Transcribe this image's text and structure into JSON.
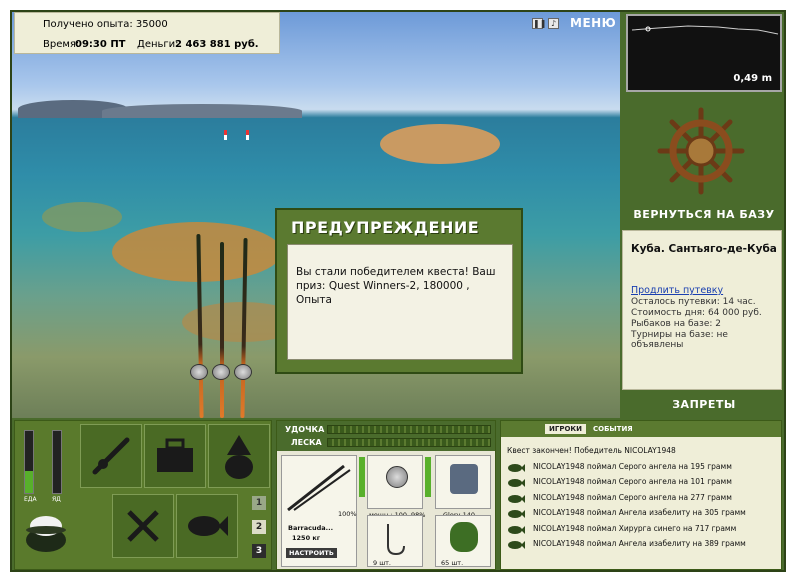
{
  "info": {
    "experience_label": "Получено опыта:",
    "experience_value": "35000",
    "time_label": "Время:",
    "time_value": "09:30 ПТ",
    "money_label": "Деньги:",
    "money_value": "2 463 881 руб."
  },
  "top_icons": [
    "pause-icon",
    "sound-icon"
  ],
  "menu_label": "МЕНЮ",
  "depth": {
    "value": "0,49 m"
  },
  "return_label": "ВЕРНУТЬСЯ НА БАЗУ",
  "location": {
    "city": "Куба. Сантьяго-де-Куба",
    "extend_link": "Продлить путевку",
    "remaining": "Осталось путевки: 14 час.",
    "day_cost": "Стоимость дня: 64 000 руб.",
    "fishers": "Рыбаков на базе: 2",
    "tournaments": "Турниры на базе: не объявлены"
  },
  "bans_label": "ЗАПРЕТЫ",
  "dialog": {
    "title": "ПРЕДУПРЕЖДЕНИЕ",
    "message": "Вы стали победителем квеста! Ваш приз: Quest Winners-2, 180000 , Опыта"
  },
  "gauges": {
    "food_label": "ЕДА",
    "drink_label": "ЯД",
    "food_level": 0.35,
    "drink_level": 0.0
  },
  "page_buttons": [
    "1",
    "2",
    "3"
  ],
  "tackle": {
    "rod_label": "УДОЧКА",
    "line_label": "ЛЕСКА",
    "rod_name": "Barracuda...",
    "rod_weight": "1250 кг",
    "rod_percent": "100%",
    "setup_button": "НАСТРОИТЬ",
    "reel_caption": "мощн.: 100",
    "reel_percent": "98%",
    "line_caption": "Glory-140...",
    "hook_caption": "9 шт.",
    "bait_caption": "65 шт."
  },
  "events": {
    "tab_players": "ИГРОКИ",
    "tab_events": "СОБЫТИЯ",
    "items": [
      "Квест закончен! Победитель NICOLAY1948",
      "NICOLAY1948 поймал Серого ангела на 195 грамм",
      "NICOLAY1948 поймал Серого ангела на 101 грамм",
      "NICOLAY1948 поймал Серого ангела на 277 грамм",
      "NICOLAY1948 поймал Ангела изабелиту на 305 грамм",
      "NICOLAY1948 поймал Хирурга синего на 717 грамм",
      "NICOLAY1948 поймал Ангела изабелиту на 389 грамм"
    ]
  },
  "colors": {
    "panel_green": "#4a6b2c",
    "panel_light": "#efeed8",
    "dialog_green": "#5b7a30"
  }
}
